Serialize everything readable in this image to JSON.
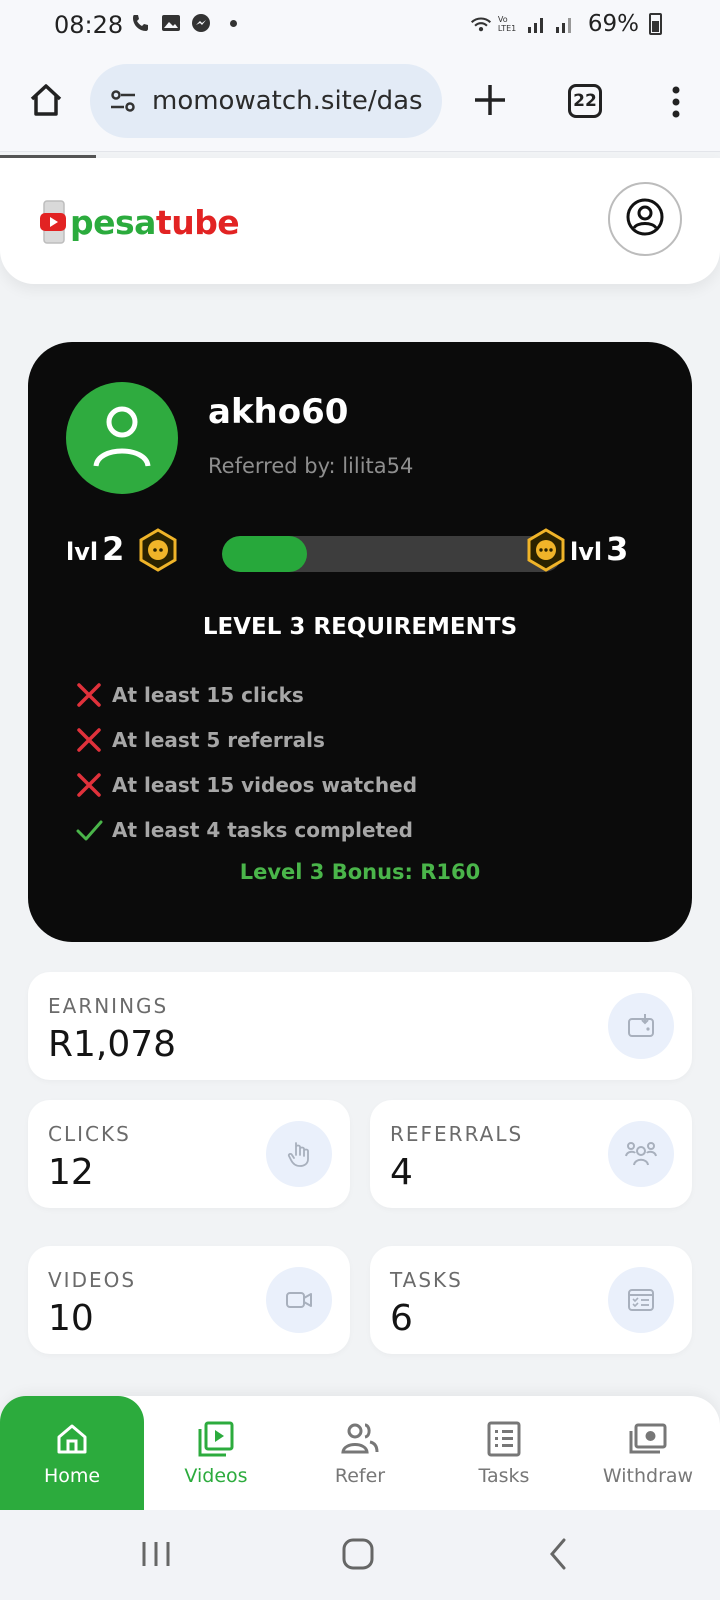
{
  "status_bar": {
    "time": "08:28",
    "battery": "69%",
    "network": "Vo LTE1"
  },
  "browser": {
    "url": "momowatch.site/das",
    "tab_count": "22"
  },
  "header": {
    "logo_part1": "pesa",
    "logo_part2": "tube"
  },
  "profile": {
    "username": "akho60",
    "referred_by": "Referred by: lilita54",
    "current_level_prefix": "lvl",
    "current_level": "2",
    "next_level_prefix": "lvl",
    "next_level": "3",
    "progress": 0.25,
    "requirements_title": "LEVEL 3 REQUIREMENTS",
    "requirements": [
      {
        "text": "At least 15 clicks",
        "met": false
      },
      {
        "text": "At least 5 referrals",
        "met": false
      },
      {
        "text": "At least 15 videos watched",
        "met": false
      },
      {
        "text": "At least 4 tasks completed",
        "met": true
      }
    ],
    "bonus": "Level 3 Bonus: R160"
  },
  "stats": {
    "earnings": {
      "label": "EARNINGS",
      "value": "R1,078",
      "icon": "wallet-icon"
    },
    "clicks": {
      "label": "CLICKS",
      "value": "12",
      "icon": "pointer-icon"
    },
    "referrals": {
      "label": "REFERRALS",
      "value": "4",
      "icon": "group-icon"
    },
    "videos": {
      "label": "VIDEOS",
      "value": "10",
      "icon": "video-camera-icon"
    },
    "tasks": {
      "label": "TASKS",
      "value": "6",
      "icon": "checklist-icon"
    }
  },
  "nav": {
    "items": [
      {
        "label": "Home",
        "icon": "home-icon"
      },
      {
        "label": "Videos",
        "icon": "video-library-icon"
      },
      {
        "label": "Refer",
        "icon": "people-icon"
      },
      {
        "label": "Tasks",
        "icon": "list-icon"
      },
      {
        "label": "Withdraw",
        "icon": "cash-icon"
      }
    ]
  },
  "colors": {
    "accent_green": "#2cab3d",
    "brand_red": "#e22323",
    "card_dark": "#0b0b0b",
    "error_red": "#e0313b",
    "badge_gold": "#f0b429"
  }
}
